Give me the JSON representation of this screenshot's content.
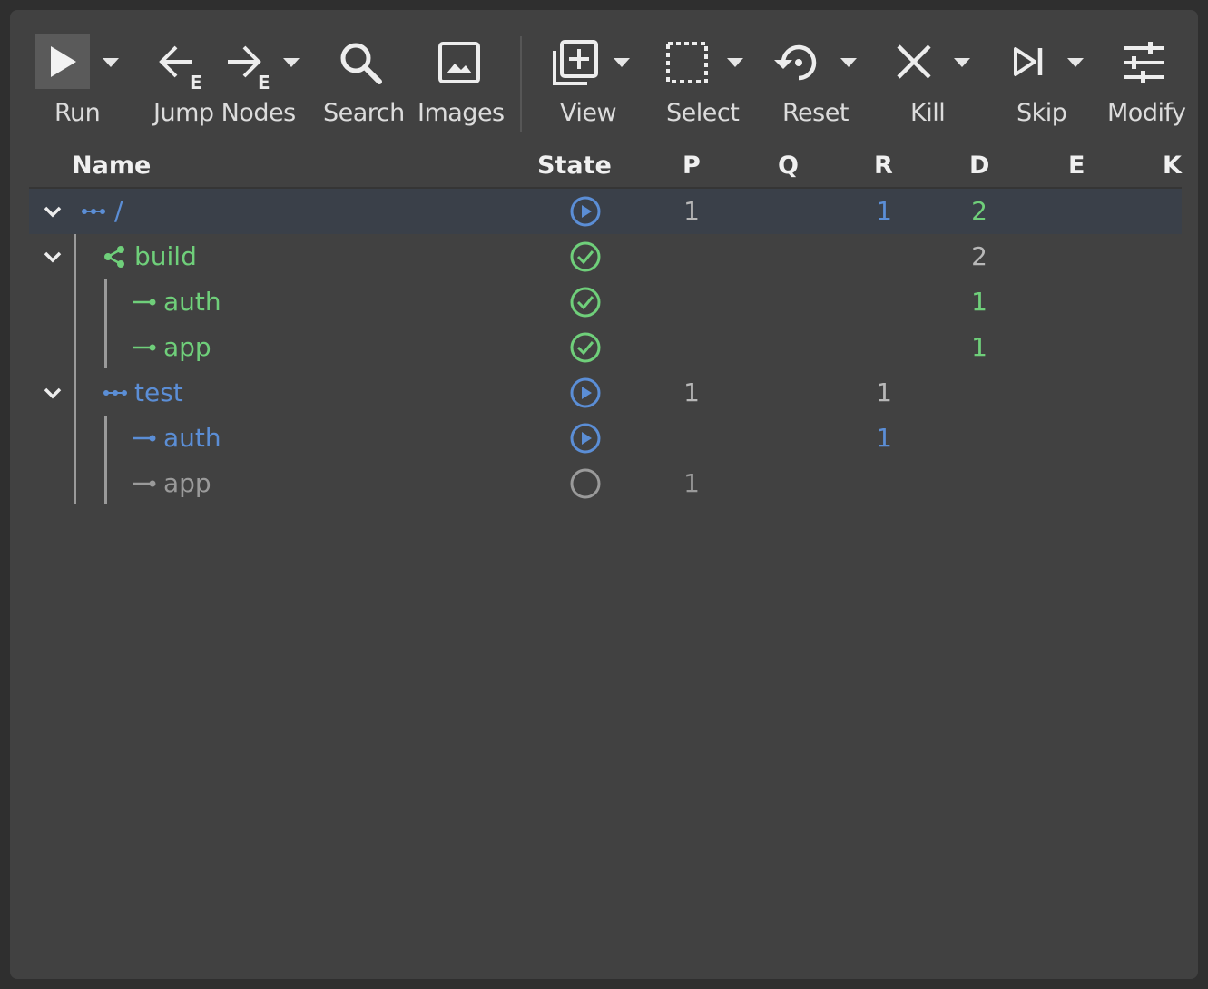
{
  "toolbar": {
    "run": "Run",
    "jump_nodes": "Jump Nodes",
    "search": "Search",
    "images": "Images",
    "view": "View",
    "select": "Select",
    "reset": "Reset",
    "kill": "Kill",
    "skip": "Skip",
    "modify": "Modify",
    "jump_subscript": "E"
  },
  "columns": [
    "Name",
    "State",
    "P",
    "Q",
    "R",
    "D",
    "E",
    "K"
  ],
  "rows": [
    {
      "name": "/",
      "state": "running",
      "P": "1",
      "Q": "",
      "R": "1",
      "D": "2",
      "E": "",
      "K": ""
    },
    {
      "name": "build",
      "state": "complete",
      "P": "",
      "Q": "",
      "R": "",
      "D": "2",
      "E": "",
      "K": ""
    },
    {
      "name": "auth",
      "state": "complete",
      "P": "",
      "Q": "",
      "R": "",
      "D": "1",
      "E": "",
      "K": ""
    },
    {
      "name": "app",
      "state": "complete",
      "P": "",
      "Q": "",
      "R": "",
      "D": "1",
      "E": "",
      "K": ""
    },
    {
      "name": "test",
      "state": "running",
      "P": "1",
      "Q": "",
      "R": "1",
      "D": "",
      "E": "",
      "K": ""
    },
    {
      "name": "auth",
      "state": "running",
      "P": "",
      "Q": "",
      "R": "1",
      "D": "",
      "E": "",
      "K": ""
    },
    {
      "name": "app",
      "state": "queued",
      "P": "1",
      "Q": "",
      "R": "",
      "D": "",
      "E": "",
      "K": ""
    }
  ],
  "colors": {
    "running": "#5b8ed6",
    "complete": "#6fcf7a",
    "queued": "#9a9a9a",
    "background": "#414141",
    "selected_row": "#3a4049"
  }
}
